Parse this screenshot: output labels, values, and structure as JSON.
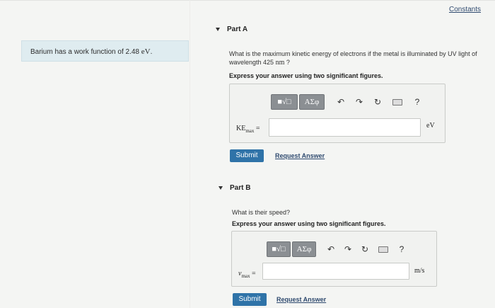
{
  "header": {
    "constants_link": "Constants"
  },
  "problem": {
    "statement_prefix": "Barium has a work function of 2.48 ",
    "statement_unit": "eV",
    "statement_suffix": "."
  },
  "part_a": {
    "heading": "Part A",
    "question_line1": "What is the maximum kinetic energy of electrons if the metal is illuminated by UV light of",
    "question_line2_prefix": "wavelength 425 ",
    "question_line2_unit": "nm",
    "question_line2_suffix": " ?",
    "instruction": "Express your answer using two significant figures.",
    "toolbar": {
      "templates_label": "■√□",
      "symbols_label": "AΣφ",
      "help_label": "?"
    },
    "variable_main": "KE",
    "variable_sub": "max",
    "equals": "=",
    "input_value": "",
    "unit": "eV",
    "submit_label": "Submit",
    "request_label": "Request Answer"
  },
  "part_b": {
    "heading": "Part B",
    "question": "What is their speed?",
    "instruction": "Express your answer using two significant figures.",
    "toolbar": {
      "templates_label": "■√□",
      "symbols_label": "AΣφ",
      "help_label": "?"
    },
    "variable_main": "v",
    "variable_sub": "max",
    "equals": "=",
    "input_value": "",
    "unit": "m/s",
    "submit_label": "Submit",
    "request_label": "Request Answer"
  }
}
